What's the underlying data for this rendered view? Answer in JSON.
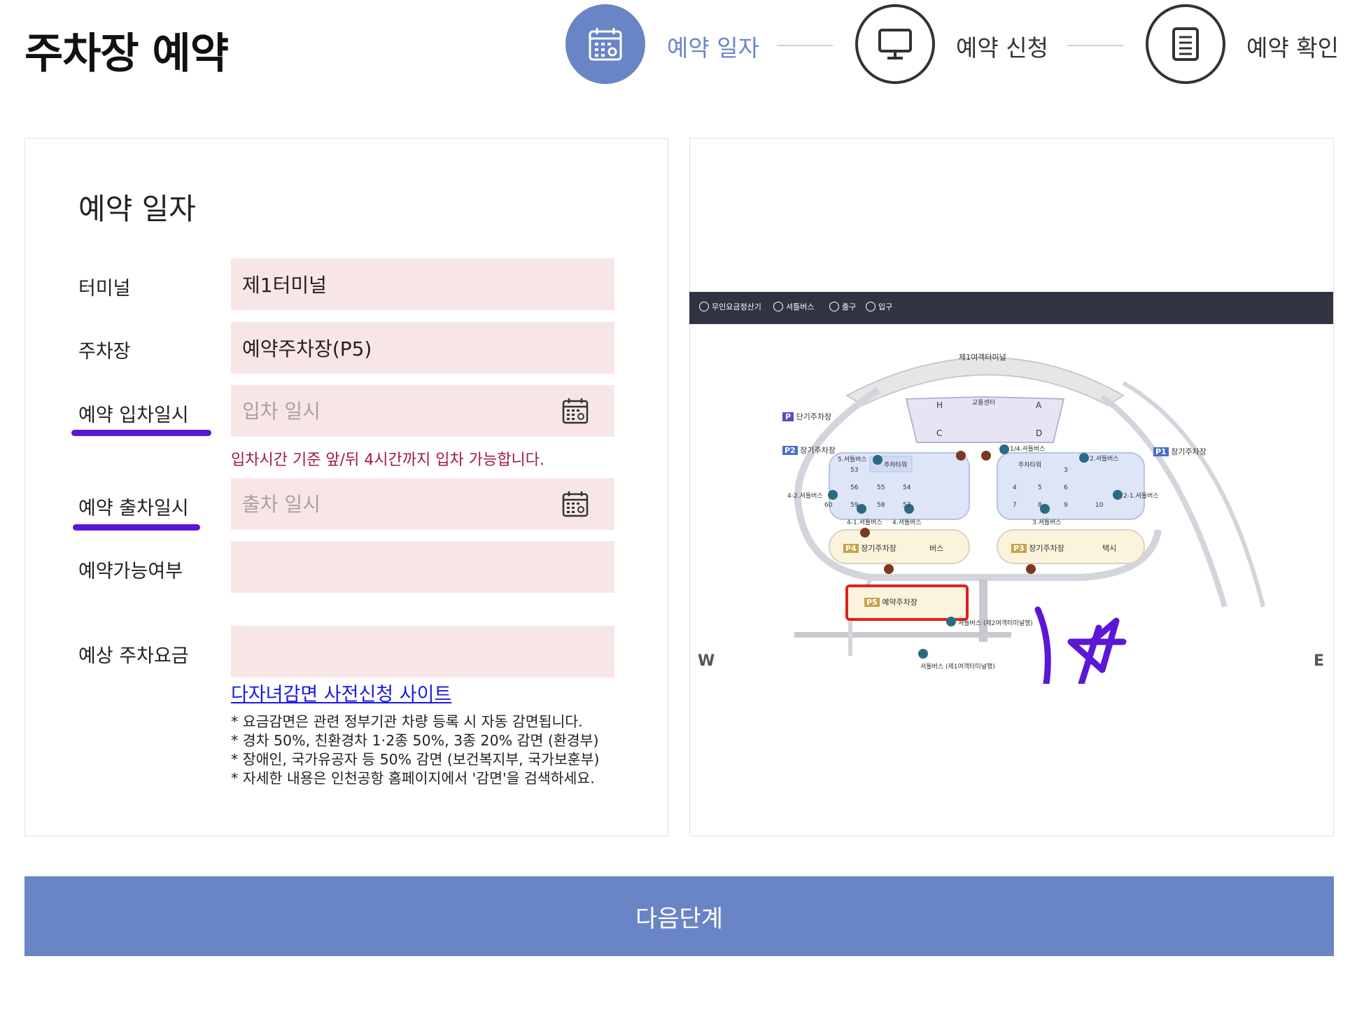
{
  "page": {
    "title": "주차장 예약"
  },
  "steps": [
    {
      "label": "예약 일자",
      "icon": "calendar-icon",
      "active": true
    },
    {
      "label": "예약 신청",
      "icon": "monitor-icon",
      "active": false
    },
    {
      "label": "예약 확인",
      "icon": "document-icon",
      "active": false
    }
  ],
  "form": {
    "section_title": "예약 일자",
    "terminal": {
      "label": "터미널",
      "value": "제1터미널"
    },
    "parking_lot": {
      "label": "주차장",
      "value": "예약주차장(P5)"
    },
    "entry_datetime": {
      "label": "예약 입차일시",
      "placeholder": "입차 일시"
    },
    "entry_hint": "입차시간 기준 앞/뒤 4시간까지 입차 가능합니다.",
    "exit_datetime": {
      "label": "예약 출차일시",
      "placeholder": "출차 일시"
    },
    "availability": {
      "label": "예약가능여부",
      "value": ""
    },
    "estimated_fee": {
      "label": "예상 주차요금",
      "value": ""
    },
    "discount_link": "다자녀감면 사전신청 사이트",
    "notes": [
      "* 요금감면은 관련 정부기관 차량 등록 시 자동 감면됩니다.",
      "* 경차 50%, 친환경차 1·2종 50%, 3종 20% 감면 (환경부)",
      "* 장애인, 국가유공자 등 50% 감면 (보건복지부, 국가보훈부)",
      "* 자세한 내용은 인천공항 홈페이지에서 '감면'을 검색하세요."
    ]
  },
  "map": {
    "legend": [
      "무인요금정산기",
      "셔틀버스",
      "출구",
      "입구"
    ],
    "terminal_label": "제1여객터미널",
    "transport_center": "교통센터",
    "gates": [
      "H",
      "A",
      "C",
      "D"
    ],
    "lots": {
      "p1": {
        "badge": "P1",
        "label": "장기주차장"
      },
      "p2": {
        "badge": "P2",
        "label": "장기주차장"
      },
      "p3": {
        "badge": "P3",
        "label": "장기주차장"
      },
      "p4": {
        "badge": "P4",
        "label": "장기주차장"
      },
      "p5": {
        "badge": "P5",
        "label": "예약주차장"
      },
      "short": {
        "badge": "P",
        "label": "단기주차장"
      }
    },
    "towers": [
      "주차타워",
      "주차타워"
    ],
    "left_block_numbers": [
      "53",
      "56",
      "55",
      "54",
      "59",
      "58",
      "57",
      "60"
    ],
    "right_block_numbers": [
      "3",
      "4",
      "5",
      "6",
      "7",
      "8",
      "9",
      "10"
    ],
    "bus_label": "버스",
    "taxi_label": "택시",
    "shuttle_stops": [
      "5.셔틀버스",
      "1/4.셔틀버스",
      "2.셔틀버스",
      "4-2.셔틀버스",
      "2-1.셔틀버스",
      "4-1.셔틀버스",
      "4.셔틀버스",
      "3.셔틀버스"
    ],
    "shuttle_t2": "셔틀버스 (제2여객터미널행)",
    "shuttle_t1": "셔틀버스 (제1여객터미널행)",
    "compass_w": "W",
    "compass_e": "E"
  },
  "next_button": "다음단계",
  "colors": {
    "accent": "#6a85c6",
    "input_bg": "#f8e6e6",
    "hint": "#a0194b",
    "annotation": "#5a17d6",
    "map_highlight": "#e02020"
  }
}
